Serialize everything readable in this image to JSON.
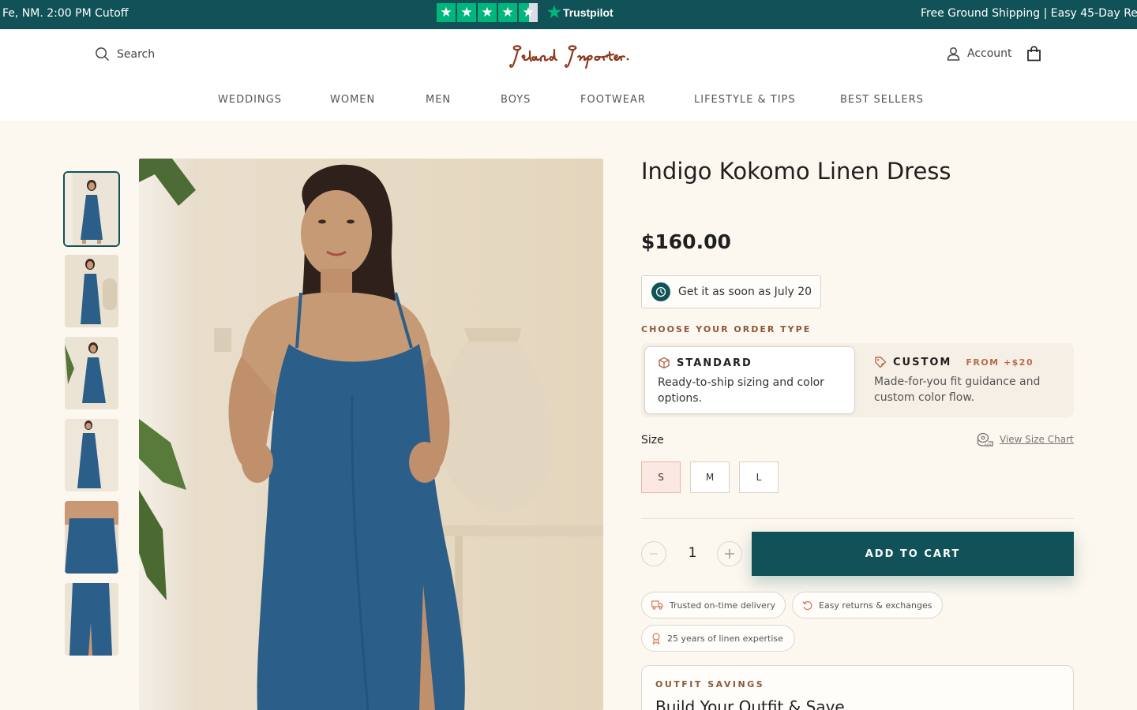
{
  "announcement": {
    "left_text": "Fe, NM. 2:00 PM Cutoff",
    "trustpilot_label": "Trustpilot",
    "trustpilot_stars": 4.5,
    "right_text": "Free Ground Shipping | Easy 45-Day Re"
  },
  "header": {
    "search_label": "Search",
    "logo_text": "Island Importer",
    "account_label": "Account",
    "cart_icon": "shopping-bag-icon"
  },
  "nav": {
    "items": [
      "WEDDINGS",
      "WOMEN",
      "MEN",
      "BOYS",
      "FOOTWEAR",
      "LIFESTYLE & TIPS",
      "BEST SELLERS"
    ]
  },
  "gallery": {
    "thumbnail_count": 6,
    "active_index": 0
  },
  "product": {
    "title": "Indigo Kokomo Linen Dress",
    "price": "$160.00",
    "delivery_text": "Get it as soon as July 20",
    "order_type_label": "CHOOSE YOUR ORDER TYPE",
    "order_types": [
      {
        "name": "STANDARD",
        "badge": "",
        "description": "Ready-to-ship sizing and color options.",
        "selected": true
      },
      {
        "name": "CUSTOM",
        "badge": "FROM +$20",
        "description": "Made-for-you fit guidance and custom color flow.",
        "selected": false
      }
    ],
    "size_label": "Size",
    "size_chart_label": "View Size Chart",
    "sizes": [
      "S",
      "M",
      "L"
    ],
    "selected_size": "S",
    "quantity": "1",
    "add_to_cart_label": "ADD TO CART",
    "trust_chips": [
      "Trusted on-time delivery",
      "Easy returns & exchanges",
      "25 years of linen expertise"
    ],
    "savings_label": "OUTFIT SAVINGS",
    "savings_title": "Build Your Outfit & Save"
  },
  "colors": {
    "brand_teal": "#115258",
    "page_bg": "#fcf7ef",
    "accent_terracotta": "#b76c4f",
    "dress_indigo": "#2b5f8a",
    "trustpilot_green": "#00b67a"
  }
}
